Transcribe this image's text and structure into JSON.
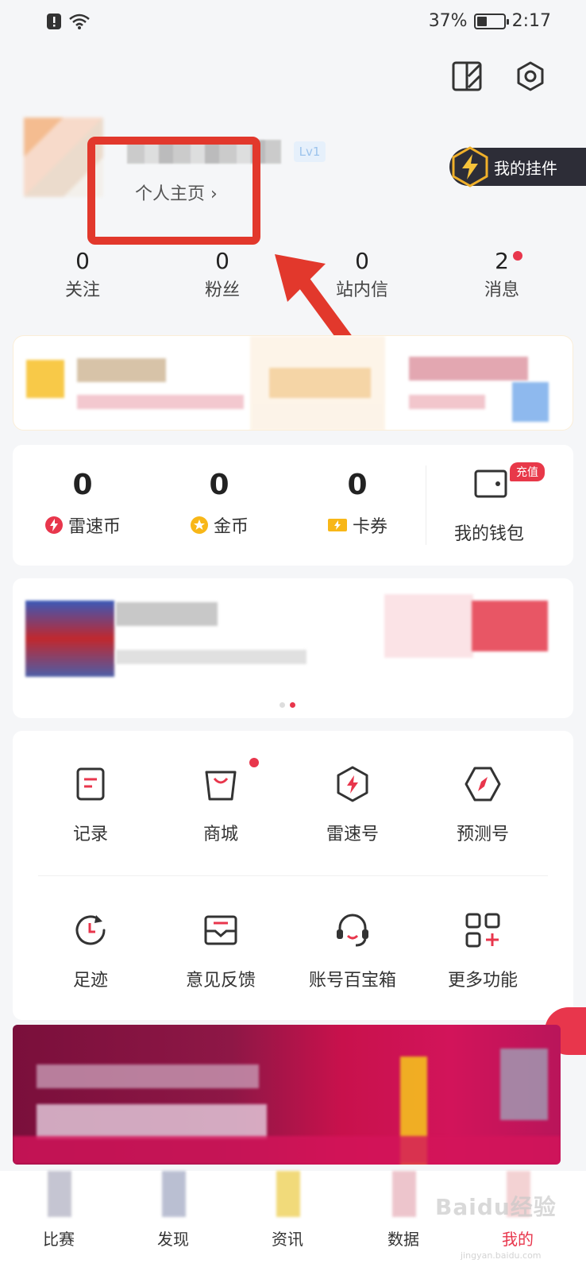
{
  "status_bar": {
    "battery_text": "37%",
    "battery_level": 0.37,
    "time": "2:17"
  },
  "profile": {
    "level_badge": "Lv1",
    "profile_link": "个人主页 ›",
    "pendant_label": "我的挂件"
  },
  "stats": [
    {
      "value": "0",
      "label": "关注"
    },
    {
      "value": "0",
      "label": "粉丝"
    },
    {
      "value": "0",
      "label": "站内信"
    },
    {
      "value": "2",
      "label": "消息"
    }
  ],
  "wallet": {
    "items": [
      {
        "value": "0",
        "label": "雷速币"
      },
      {
        "value": "0",
        "label": "金币"
      },
      {
        "value": "0",
        "label": "卡券"
      }
    ],
    "recharge_badge": "充值",
    "wallet_label": "我的钱包"
  },
  "functions": [
    {
      "label": "记录",
      "icon": "record-icon"
    },
    {
      "label": "商城",
      "icon": "shop-bag-icon"
    },
    {
      "label": "雷速号",
      "icon": "leisu-account-icon"
    },
    {
      "label": "预测号",
      "icon": "compass-icon"
    },
    {
      "label": "足迹",
      "icon": "history-icon"
    },
    {
      "label": "意见反馈",
      "icon": "mail-icon"
    },
    {
      "label": "账号百宝箱",
      "icon": "headset-icon"
    },
    {
      "label": "更多功能",
      "icon": "more-grid-icon"
    }
  ],
  "tabs": [
    {
      "label": "比赛"
    },
    {
      "label": "发现"
    },
    {
      "label": "资讯"
    },
    {
      "label": "数据"
    },
    {
      "label": "我的"
    }
  ],
  "watermark": {
    "brand": "Baidu经验",
    "url": "jingyan.baidu.com"
  },
  "colors": {
    "accent": "#e8364c",
    "highlight": "#e2382c",
    "background": "#f5f6f8"
  }
}
